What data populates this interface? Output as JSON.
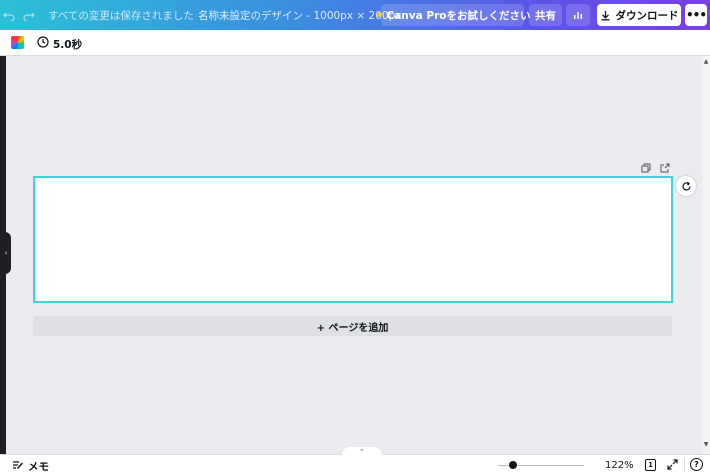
{
  "topbar": {
    "saved_status": "すべての変更は保存されました",
    "design_title": "名称未設定のデザイン - 1000px × 200px",
    "pro_star": "★",
    "pro_label": "Canva Proをお試しください",
    "share_label": "共有",
    "download_label": "ダウンロード",
    "more_label": "•••",
    "icons": [
      "undo-icon",
      "redo-icon",
      "insights-icon",
      "download-icon"
    ]
  },
  "toolbar": {
    "timer_label": "5.0秒",
    "icons": [
      "color-swatch",
      "clock-icon"
    ]
  },
  "canvas": {
    "add_page_label": "+ ページを追加",
    "accent_color": "#3dd6d8",
    "page_actions": [
      "duplicate-page-icon",
      "add-page-icon"
    ]
  },
  "left_panel": {
    "handle_glyph": "‹"
  },
  "scrollbar": {
    "up_glyph": "▲",
    "down_glyph": "▼"
  },
  "bottombar": {
    "notes_tab_glyph": "⌃",
    "memo_label": "メモ",
    "zoom_label": "122%",
    "zoom_level": 0.18,
    "page_count": "1",
    "help_label": "?"
  },
  "colors": {
    "gradient_start": "#2bbfd6",
    "gradient_end": "#7b3fe4",
    "canvas_bg": "#ebecf0"
  }
}
